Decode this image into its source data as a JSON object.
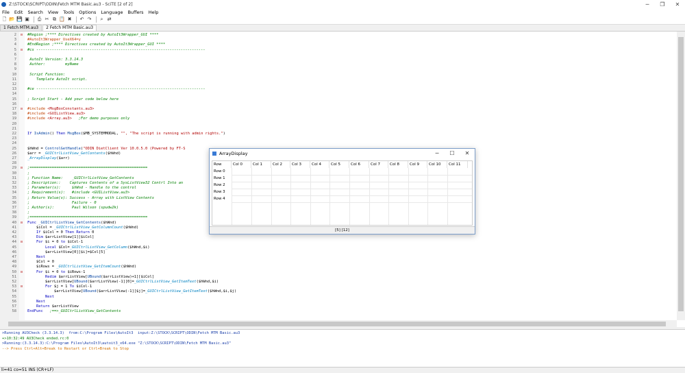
{
  "window": {
    "title": "Z:\\STOCK\\SCRIPT\\ODIN\\Fetch MTM Basic.au3 - SciTE [2 of 2]",
    "minimize": "─",
    "maximize": "❐",
    "close": "✕"
  },
  "menu": [
    "File",
    "Edit",
    "Search",
    "View",
    "Tools",
    "Options",
    "Language",
    "Buffers",
    "Help"
  ],
  "toolbar_icons": [
    "new-icon",
    "open-icon",
    "save-icon",
    "close-file-icon",
    "print-icon",
    "cut-icon",
    "copy-icon",
    "paste-icon",
    "delete-icon",
    "undo-icon",
    "redo-icon",
    "find-icon",
    "replace-icon"
  ],
  "tabs": [
    {
      "label": "1 Fetch MTM.au3",
      "active": false
    },
    {
      "label": "2 Fetch MTM Basic.au3",
      "active": true
    }
  ],
  "code_lines": [
    {
      "n": "2",
      "fold": "⊟",
      "parts": [
        {
          "t": "#Region ;**** Directives created by AutoIt3Wrapper_GUI ****",
          "c": "c-comment"
        }
      ]
    },
    {
      "n": "3",
      "fold": "",
      "parts": [
        {
          "t": "#AutoIt3Wrapper_UseX64=y",
          "c": "c-directive"
        }
      ]
    },
    {
      "n": "4",
      "fold": "",
      "parts": [
        {
          "t": "#EndRegion ;**** Directives created by AutoIt3Wrapper_GUI ****",
          "c": "c-comment"
        }
      ]
    },
    {
      "n": "5",
      "fold": "⊟",
      "parts": [
        {
          "t": "#cs ----------------------------------------------------------------------------",
          "c": "c-comment"
        }
      ]
    },
    {
      "n": "6",
      "fold": "",
      "parts": [
        {
          "t": "",
          "c": ""
        }
      ]
    },
    {
      "n": "7",
      "fold": "",
      "parts": [
        {
          "t": " AutoIt Version: 3.3.14.3",
          "c": "c-comment"
        }
      ]
    },
    {
      "n": "8",
      "fold": "",
      "parts": [
        {
          "t": " Author:         myName",
          "c": "c-comment"
        }
      ]
    },
    {
      "n": "9",
      "fold": "",
      "parts": [
        {
          "t": "",
          "c": ""
        }
      ]
    },
    {
      "n": "10",
      "fold": "",
      "parts": [
        {
          "t": " Script Function:",
          "c": "c-comment"
        }
      ]
    },
    {
      "n": "11",
      "fold": "",
      "parts": [
        {
          "t": "    Template AutoIt script.",
          "c": "c-comment"
        }
      ]
    },
    {
      "n": "12",
      "fold": "",
      "parts": [
        {
          "t": "",
          "c": ""
        }
      ]
    },
    {
      "n": "13",
      "fold": "",
      "parts": [
        {
          "t": "#ce ----------------------------------------------------------------------------",
          "c": "c-comment"
        }
      ]
    },
    {
      "n": "14",
      "fold": "",
      "parts": [
        {
          "t": "",
          "c": ""
        }
      ]
    },
    {
      "n": "15",
      "fold": "",
      "parts": [
        {
          "t": "; Script Start - Add your code below here",
          "c": "c-comment"
        }
      ]
    },
    {
      "n": "16",
      "fold": "",
      "parts": [
        {
          "t": "",
          "c": ""
        }
      ]
    },
    {
      "n": "17",
      "fold": "⊟",
      "parts": [
        {
          "t": "#include ",
          "c": "c-directive"
        },
        {
          "t": "<MsgBoxConstants.au3>",
          "c": "c-string"
        }
      ]
    },
    {
      "n": "18",
      "fold": "",
      "parts": [
        {
          "t": "#include ",
          "c": "c-directive"
        },
        {
          "t": "<GUIListView.au3>",
          "c": "c-string"
        }
      ]
    },
    {
      "n": "19",
      "fold": "",
      "parts": [
        {
          "t": "#include ",
          "c": "c-directive"
        },
        {
          "t": "<Array.au3>",
          "c": "c-string"
        },
        {
          "t": "   ;For demo purposes only",
          "c": "c-comment"
        }
      ]
    },
    {
      "n": "20",
      "fold": "",
      "parts": [
        {
          "t": "",
          "c": ""
        }
      ]
    },
    {
      "n": "21",
      "fold": "",
      "parts": [
        {
          "t": "",
          "c": ""
        }
      ]
    },
    {
      "n": "22",
      "fold": "",
      "parts": [
        {
          "t": "If ",
          "c": "c-keyword"
        },
        {
          "t": "IsAdmin",
          "c": "c-func"
        },
        {
          "t": "() ",
          "c": ""
        },
        {
          "t": "Then ",
          "c": "c-keyword"
        },
        {
          "t": "MsgBox",
          "c": "c-func"
        },
        {
          "t": "($MB_SYSTEMMODAL, ",
          "c": ""
        },
        {
          "t": "\"\", \"The script is running with admin rights.\"",
          "c": "c-string"
        },
        {
          "t": ")",
          "c": ""
        }
      ]
    },
    {
      "n": "23",
      "fold": "",
      "parts": [
        {
          "t": "",
          "c": ""
        }
      ]
    },
    {
      "n": "24",
      "fold": "",
      "parts": [
        {
          "t": "",
          "c": ""
        }
      ]
    },
    {
      "n": "25",
      "fold": "",
      "parts": [
        {
          "t": "$hWnd = ",
          "c": ""
        },
        {
          "t": "ControlGetHandle",
          "c": "c-func"
        },
        {
          "t": "(",
          "c": ""
        },
        {
          "t": "\"ODIN DietClient Ver 10.0.5.0 (Powered by FT-S",
          "c": "c-string"
        }
      ]
    },
    {
      "n": "26",
      "fold": "",
      "parts": [
        {
          "t": "$arr = ",
          "c": ""
        },
        {
          "t": "_GUICtrlListView_GetContents",
          "c": "c-udf"
        },
        {
          "t": "($hWnd)",
          "c": ""
        }
      ]
    },
    {
      "n": "27",
      "fold": "",
      "parts": [
        {
          "t": "_ArrayDisplay",
          "c": "c-udf"
        },
        {
          "t": "($arr)",
          "c": ""
        }
      ]
    },
    {
      "n": "28",
      "fold": "",
      "parts": [
        {
          "t": "",
          "c": ""
        }
      ]
    },
    {
      "n": "29",
      "fold": "⊟",
      "parts": [
        {
          "t": ";=====================================================",
          "c": "c-comment"
        }
      ]
    },
    {
      "n": "30",
      "fold": "",
      "parts": [
        {
          "t": ";",
          "c": "c-comment"
        }
      ]
    },
    {
      "n": "31",
      "fold": "",
      "parts": [
        {
          "t": "; Function Name:    _GUICtrlListView_GetContents",
          "c": "c-comment"
        }
      ]
    },
    {
      "n": "32",
      "fold": "",
      "parts": [
        {
          "t": "; Description::    Captures Contents of a SysListView32 Contrl Into an",
          "c": "c-comment"
        }
      ]
    },
    {
      "n": "33",
      "fold": "",
      "parts": [
        {
          "t": "; Parameter(s):     $hWnd - Handle to the control",
          "c": "c-comment"
        }
      ]
    },
    {
      "n": "34",
      "fold": "",
      "parts": [
        {
          "t": "; Requirement(s):   #include <GUIListView.au3>",
          "c": "c-comment"
        }
      ]
    },
    {
      "n": "35",
      "fold": "",
      "parts": [
        {
          "t": "; Return Value(s): Success - Array with ListView Contents",
          "c": "c-comment"
        }
      ]
    },
    {
      "n": "36",
      "fold": "",
      "parts": [
        {
          "t": ";                   Failure - 0",
          "c": "c-comment"
        }
      ]
    },
    {
      "n": "37",
      "fold": "",
      "parts": [
        {
          "t": "; Author(s):        Paul Wilson (spudw2k)",
          "c": "c-comment"
        }
      ]
    },
    {
      "n": "38",
      "fold": "",
      "parts": [
        {
          "t": ";",
          "c": "c-comment"
        }
      ]
    },
    {
      "n": "39",
      "fold": "",
      "parts": [
        {
          "t": ";=====================================================",
          "c": "c-comment"
        }
      ]
    },
    {
      "n": "40",
      "fold": "⊟",
      "parts": [
        {
          "t": "Func ",
          "c": "c-keyword"
        },
        {
          "t": "_GUICtrlListView_GetContents",
          "c": "c-func"
        },
        {
          "t": "($hWnd)",
          "c": ""
        }
      ]
    },
    {
      "n": "41",
      "fold": "",
      "parts": [
        {
          "t": "    $iCol = ",
          "c": ""
        },
        {
          "t": "_GUICtrlListView_GetColumnCount",
          "c": "c-udf"
        },
        {
          "t": "($hWnd)",
          "c": ""
        }
      ]
    },
    {
      "n": "42",
      "fold": "",
      "parts": [
        {
          "t": "    If ",
          "c": "c-keyword"
        },
        {
          "t": "$iCol = 0 ",
          "c": ""
        },
        {
          "t": "Then Return ",
          "c": "c-keyword"
        },
        {
          "t": "0",
          "c": ""
        }
      ]
    },
    {
      "n": "43",
      "fold": "",
      "parts": [
        {
          "t": "    Dim ",
          "c": "c-keyword"
        },
        {
          "t": "$arrListView[1][$iCol]",
          "c": ""
        }
      ]
    },
    {
      "n": "44",
      "fold": "⊟",
      "parts": [
        {
          "t": "    For ",
          "c": "c-keyword"
        },
        {
          "t": "$i = 0 ",
          "c": ""
        },
        {
          "t": "to ",
          "c": "c-keyword"
        },
        {
          "t": "$iCol-1",
          "c": ""
        }
      ]
    },
    {
      "n": "45",
      "fold": "",
      "parts": [
        {
          "t": "        Local ",
          "c": "c-keyword"
        },
        {
          "t": "$Col=",
          "c": ""
        },
        {
          "t": "_GUICtrlListView_GetColumn",
          "c": "c-udf"
        },
        {
          "t": "($hWnd,$i)",
          "c": ""
        }
      ]
    },
    {
      "n": "46",
      "fold": "",
      "parts": [
        {
          "t": "        $arrListView[0][$i]=$Col[5]",
          "c": ""
        }
      ]
    },
    {
      "n": "47",
      "fold": "",
      "parts": [
        {
          "t": "    Next",
          "c": "c-keyword"
        }
      ]
    },
    {
      "n": "48",
      "fold": "",
      "parts": [
        {
          "t": "    $Col = 0",
          "c": ""
        }
      ]
    },
    {
      "n": "49",
      "fold": "",
      "parts": [
        {
          "t": "    $iRows = ",
          "c": ""
        },
        {
          "t": "_GUICtrlListView_GetItemCount",
          "c": "c-udf"
        },
        {
          "t": "($hWnd)",
          "c": ""
        }
      ]
    },
    {
      "n": "50",
      "fold": "⊟",
      "parts": [
        {
          "t": "    For ",
          "c": "c-keyword"
        },
        {
          "t": "$i = 0 ",
          "c": ""
        },
        {
          "t": "to ",
          "c": "c-keyword"
        },
        {
          "t": "$iRows-1",
          "c": ""
        }
      ]
    },
    {
      "n": "51",
      "fold": "",
      "parts": [
        {
          "t": "        Redim ",
          "c": "c-keyword"
        },
        {
          "t": "$arrListView[",
          "c": ""
        },
        {
          "t": "UBound",
          "c": "c-func"
        },
        {
          "t": "($arrListView)+1][$iCol]",
          "c": ""
        }
      ]
    },
    {
      "n": "52",
      "fold": "",
      "parts": [
        {
          "t": "        $arrListView[",
          "c": ""
        },
        {
          "t": "UBound",
          "c": "c-func"
        },
        {
          "t": "($arrListView)-1][0]=",
          "c": ""
        },
        {
          "t": "_GUICtrlListView_GetItemText",
          "c": "c-udf"
        },
        {
          "t": "($hWnd,$i)",
          "c": ""
        }
      ]
    },
    {
      "n": "53",
      "fold": "⊟",
      "parts": [
        {
          "t": "        For ",
          "c": "c-keyword"
        },
        {
          "t": "$j = 1 ",
          "c": ""
        },
        {
          "t": "To ",
          "c": "c-keyword"
        },
        {
          "t": "$iCol-1",
          "c": ""
        }
      ]
    },
    {
      "n": "54",
      "fold": "",
      "parts": [
        {
          "t": "            $arrListView[",
          "c": ""
        },
        {
          "t": "UBound",
          "c": "c-func"
        },
        {
          "t": "($arrListView)-1][$j]=",
          "c": ""
        },
        {
          "t": "_GUICtrlListView_GetItemText",
          "c": "c-udf"
        },
        {
          "t": "($hWnd,$i,$j)",
          "c": ""
        }
      ]
    },
    {
      "n": "55",
      "fold": "",
      "parts": [
        {
          "t": "        Next",
          "c": "c-keyword"
        }
      ]
    },
    {
      "n": "56",
      "fold": "",
      "parts": [
        {
          "t": "    Next",
          "c": "c-keyword"
        }
      ]
    },
    {
      "n": "57",
      "fold": "",
      "parts": [
        {
          "t": "    Return ",
          "c": "c-keyword"
        },
        {
          "t": "$arrListView",
          "c": ""
        }
      ]
    },
    {
      "n": "58",
      "fold": "",
      "parts": [
        {
          "t": "EndFunc ",
          "c": "c-keyword"
        },
        {
          "t": "  ;==>_GUICtrlListView_GetContents",
          "c": "c-comment"
        }
      ]
    }
  ],
  "output_lines": [
    {
      "t": ">Running AU3Check (3.3.14.3)  from:C:\\Program Files\\AutoIt3  input:Z:\\STOCK\\SCRIPT\\ODIN\\Fetch MTM Basic.au3",
      "c": "out-blue"
    },
    {
      "t": "+>10:32:49 AU3Check ended.rc:0",
      "c": "out-green"
    },
    {
      "t": ">Running:(3.3.14.3):C:\\Program Files\\AutoIt3\\autoit3_x64.exe \"Z:\\STOCK\\SCRIPT\\ODIN\\Fetch MTM Basic.au3\"",
      "c": "out-blue"
    },
    {
      "t": "--> Press Ctrl+Alt+Break to Restart or Ctrl+Break to Stop",
      "c": "out-orange"
    }
  ],
  "statusbar": "li=41 co=51 INS (CR+LF)",
  "array_display": {
    "title": "ArrayDisplay",
    "minimize": "─",
    "maximize": "☐",
    "close": "✕",
    "headers": [
      "Row",
      "Col 0",
      "Col 1",
      "Col 2",
      "Col 3",
      "Col 4",
      "Col 5",
      "Col 6",
      "Col 7",
      "Col 8",
      "Col 9",
      "Col 10",
      "Col 11"
    ],
    "rows": [
      "Row 0",
      "Row 1",
      "Row 2",
      "Row 3",
      "Row 4"
    ],
    "status": "[5] [12]"
  }
}
